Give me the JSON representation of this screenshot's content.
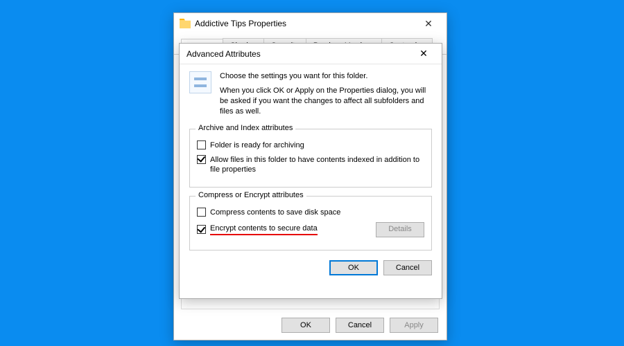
{
  "properties": {
    "title": "Addictive Tips Properties",
    "tabs": [
      "General",
      "Sharing",
      "Security",
      "Previous Versions",
      "Customize"
    ],
    "active_tab": 0,
    "buttons": {
      "ok": "OK",
      "cancel": "Cancel",
      "apply": "Apply"
    }
  },
  "advanced": {
    "title": "Advanced Attributes",
    "intro_line1": "Choose the settings you want for this folder.",
    "intro_line2": "When you click OK or Apply on the Properties dialog, you will be asked if you want the changes to affect all subfolders and files as well.",
    "group_archive": {
      "legend": "Archive and Index attributes",
      "ready_label": "Folder is ready for archiving",
      "ready_checked": false,
      "index_label": "Allow files in this folder to have contents indexed in addition to file properties",
      "index_checked": true
    },
    "group_compress": {
      "legend": "Compress or Encrypt attributes",
      "compress_label": "Compress contents to save disk space",
      "compress_checked": false,
      "encrypt_label": "Encrypt contents to secure data",
      "encrypt_checked": true,
      "details_label": "Details"
    },
    "buttons": {
      "ok": "OK",
      "cancel": "Cancel"
    }
  }
}
